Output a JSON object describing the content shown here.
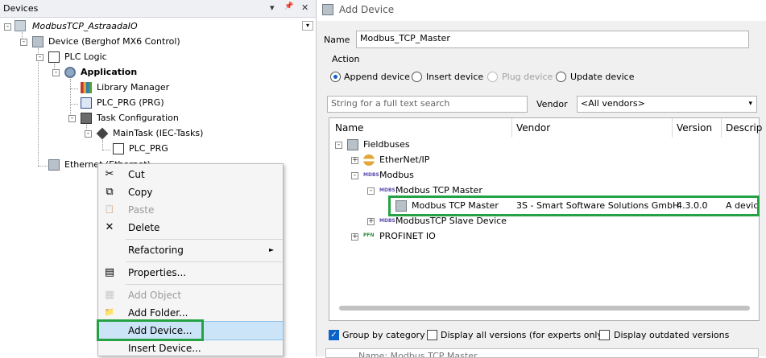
{
  "devices_panel": {
    "title": "Devices",
    "pin_glyph": "▾",
    "pin2_glyph": "📌",
    "close_glyph": "✕",
    "dropdown_glyph": "▾",
    "tree": [
      {
        "label": "ModbusTCP_AstraadaIO",
        "icon": "project-icon"
      },
      {
        "label": "Device (Berghof MX6 Control)",
        "icon": "device-icon"
      },
      {
        "label": "PLC Logic",
        "icon": "plc-logic-icon"
      },
      {
        "label": "Application",
        "icon": "application-icon"
      },
      {
        "label": "Library Manager",
        "icon": "library-icon"
      },
      {
        "label": "PLC_PRG (PRG)",
        "icon": "program-icon"
      },
      {
        "label": "Task Configuration",
        "icon": "task-config-icon"
      },
      {
        "label": "MainTask (IEC-Tasks)",
        "icon": "task-icon"
      },
      {
        "label": "PLC_PRG",
        "icon": "program-call-icon"
      },
      {
        "label": "Ethernet (Ethernet)",
        "icon": "ethernet-icon"
      }
    ]
  },
  "context_menu": {
    "items": [
      {
        "label": "Cut",
        "icon": "scissors-icon",
        "glyph": "✂",
        "disabled": false
      },
      {
        "label": "Copy",
        "icon": "copy-icon",
        "glyph": "⧉",
        "disabled": false
      },
      {
        "label": "Paste",
        "icon": "paste-icon",
        "glyph": "📋",
        "disabled": true
      },
      {
        "label": "Delete",
        "icon": "delete-icon",
        "glyph": "✕",
        "disabled": false
      },
      {
        "label": "Refactoring",
        "icon": "",
        "glyph": "",
        "disabled": false,
        "submenu": "►"
      },
      {
        "label": "Properties...",
        "icon": "properties-icon",
        "glyph": "▤",
        "disabled": false
      },
      {
        "label": "Add Object",
        "icon": "add-object-icon",
        "glyph": "▦",
        "disabled": true
      },
      {
        "label": "Add Folder...",
        "icon": "folder-icon",
        "glyph": "📁",
        "disabled": false
      },
      {
        "label": "Add Device...",
        "icon": "",
        "glyph": "",
        "disabled": false
      },
      {
        "label": "Insert Device...",
        "icon": "",
        "glyph": "",
        "disabled": false
      }
    ]
  },
  "dialog": {
    "title": "Add Device",
    "name_label": "Name",
    "name_value": "Modbus_TCP_Master",
    "action_label": "Action",
    "actions": [
      "Append device",
      "Insert device",
      "Plug device",
      "Update device"
    ],
    "search_placeholder": "String for a full text search",
    "vendor_label": "Vendor",
    "vendor_value": "<All vendors>",
    "columns": [
      "Name",
      "Vendor",
      "Version",
      "Descrip"
    ],
    "rows": [
      {
        "name": "Fieldbuses",
        "icon": "fieldbus-icon",
        "vendor": "",
        "version": "",
        "desc": ""
      },
      {
        "name": "EtherNet/IP",
        "icon": "ethernetip-icon",
        "vendor": "",
        "version": "",
        "desc": ""
      },
      {
        "name": "Modbus",
        "icon": "modbus-icon",
        "vendor": "",
        "version": "",
        "desc": ""
      },
      {
        "name": "Modbus TCP Master",
        "icon": "modbus-icon",
        "vendor": "",
        "version": "",
        "desc": ""
      },
      {
        "name": "Modbus TCP Master",
        "icon": "device-icon",
        "vendor": "3S - Smart Software Solutions GmbH",
        "version": "4.3.0.0",
        "desc": "A device"
      },
      {
        "name": "ModbusTCP Slave Device",
        "icon": "modbus-icon",
        "vendor": "",
        "version": "",
        "desc": ""
      },
      {
        "name": "PROFINET IO",
        "icon": "profinet-icon",
        "vendor": "",
        "version": "",
        "desc": ""
      }
    ],
    "options": [
      "Group by category",
      "Display all versions (for experts only)",
      "Display outdated versions"
    ],
    "footer_partial": "Name: Modbus TCP Master"
  },
  "colors": {
    "highlight": "#25a244",
    "selection": "#cce4f7",
    "accent": "#0b62c8"
  }
}
